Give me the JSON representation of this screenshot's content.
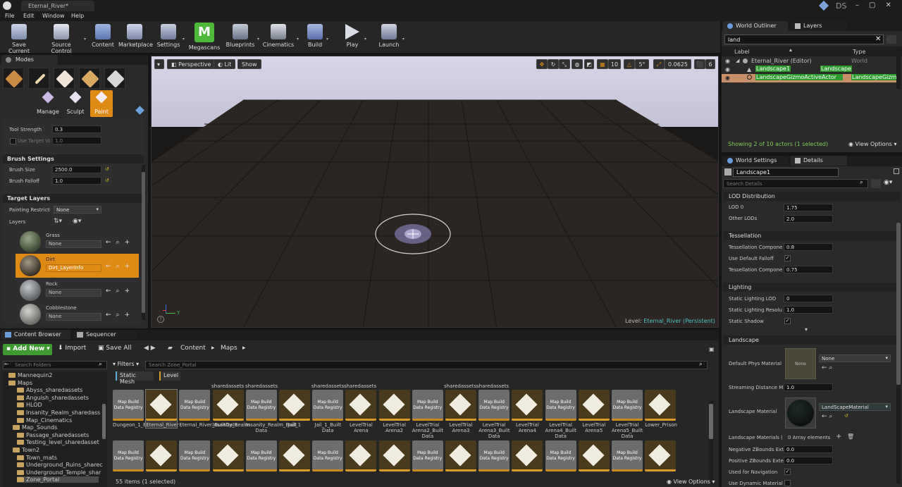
{
  "window": {
    "doc_tab": "Eternal_River*",
    "user": "DS"
  },
  "menu": [
    "File",
    "Edit",
    "Window",
    "Help"
  ],
  "toolbar": [
    "Save Current",
    "Source Control",
    "Content",
    "Marketplace",
    "Settings",
    "Megascans",
    "Blueprints",
    "Cinematics",
    "Build",
    "Play",
    "Launch"
  ],
  "modes": {
    "title": "Modes",
    "tabs": [
      "Manage",
      "Sculpt",
      "Paint"
    ],
    "tool_strength_label": "Tool Strength",
    "tool_strength": "0.3",
    "use_target_label": "Use Target Va",
    "use_target_value": "1.0",
    "brush_settings": "Brush Settings",
    "brush_size_label": "Brush Size",
    "brush_size": "2500.0",
    "brush_falloff_label": "Brush Falloff",
    "brush_falloff": "1.0",
    "target_layers": "Target Layers",
    "painting_restriction_label": "Painting Restricti",
    "painting_restriction": "None",
    "layers_label": "Layers",
    "layers": [
      {
        "name": "Grass",
        "info": "None",
        "color": "#5b6b3f"
      },
      {
        "name": "Dirt",
        "info": "Dirt_LayerInfo",
        "color": "#5c4f3e"
      },
      {
        "name": "Rock",
        "info": "None",
        "color": "#8a8c8e"
      },
      {
        "name": "Cobblestone",
        "info": "None",
        "color": "#9a9c98"
      }
    ]
  },
  "viewport": {
    "perspective": "Perspective",
    "lit": "Lit",
    "show": "Show",
    "grid_snap": "10",
    "rot_snap": "5°",
    "scale_snap": "0.0625",
    "cam_speed": "6",
    "level_label": "Level:",
    "level_name": "Eternal_River (Persistent)"
  },
  "outliner": {
    "tabs": [
      "World Outliner",
      "Layers"
    ],
    "search": "land",
    "col_label": "Label",
    "col_type": "Type",
    "rows": [
      {
        "label": "Eternal_River (Editor)",
        "type": "World"
      },
      {
        "label": "Landscape1",
        "type": "Landscape"
      },
      {
        "label": "LandscapeGizmoActiveActor",
        "type": "LandscapeGizmoA"
      }
    ],
    "status": "Showing 2 of 10 actors (1 selected)",
    "view_options": "View Options"
  },
  "details": {
    "tabs": [
      "World Settings",
      "Details"
    ],
    "object_name": "Landscape1",
    "search_placeholder": "Search Details",
    "lod_section": "LOD Distribution",
    "lod0_label": "LOD 0",
    "lod0": "1.75",
    "other_lods_label": "Other LODs",
    "other_lods": "2.0",
    "tess_section": "Tessellation",
    "tess1_label": "Tessellation Compone",
    "tess1": "0.8",
    "default_falloff_label": "Use Default Falloff",
    "tess2_label": "Tessellation Compone",
    "tess2": "0.75",
    "lighting_section": "Lighting",
    "static_lod_label": "Static Lighting LOD",
    "static_lod": "0",
    "static_res_label": "Static Lighting Resolu",
    "static_res": "1.0",
    "static_shadow_label": "Static Shadow",
    "landscape_section": "Landscape",
    "phys_mat_label": "Default Phys Material",
    "phys_mat": "None",
    "phys_thumb": "None",
    "stream_label": "Streaming Distance M",
    "stream": "1.0",
    "land_mat_label": "Landscape Material",
    "land_mat": "LandScapeMaterial",
    "land_mats_label": "Landscape Materials (",
    "land_mats_value": "0 Array elements",
    "neg_z_label": "Negative ZBounds Ext",
    "neg_z": "0.0",
    "pos_z_label": "Positive ZBounds Exte",
    "pos_z": "0.0",
    "nav_label": "Used for Navigation",
    "dyn_label": "Use Dynamic Material"
  },
  "content_browser": {
    "tabs": [
      "Content Browser",
      "Sequencer"
    ],
    "add_new": "Add New",
    "import": "Import",
    "save_all": "Save All",
    "path": [
      "Content",
      "Maps"
    ],
    "search_folders": "Search Folders",
    "filters": "Filters",
    "search_assets": "Search Zone_Portal",
    "chips": [
      "Static Mesh",
      "Level"
    ],
    "folders": [
      "Mannequin2",
      "Maps",
      "Abyss_sharedassets",
      "Anguish_sharedassets",
      "HLOD",
      "Insanity_Realm_sharedass",
      "Map_Cinematics",
      "Map_Sounds",
      "Passage_sharedassets",
      "Testing_level_sharedasset",
      "Town2",
      "Town_mats",
      "Underground_Ruins_sharec",
      "Underground_Temple_shar",
      "Zone_Portal"
    ],
    "top_overflow": [
      "sharedassets",
      "sharedassets",
      "sharedassets",
      "sharedassets"
    ],
    "row1": [
      {
        "kind": "mbdr",
        "cap": "Dungeon_1_BuiltData"
      },
      {
        "kind": "world",
        "cap": "Eternal_River"
      },
      {
        "kind": "mbdr",
        "cap": "Eternal_River_BuiltData"
      },
      {
        "kind": "world",
        "cap": "Insanity_Realm"
      },
      {
        "kind": "mbdr",
        "cap": "Insanity_Realm_Built Data"
      },
      {
        "kind": "world",
        "cap": "Jail_1"
      },
      {
        "kind": "mbdr",
        "cap": "Jail_1_Built Data"
      },
      {
        "kind": "world",
        "cap": "LevelTrial Arena"
      },
      {
        "kind": "world",
        "cap": "LevelTrial Arena2"
      },
      {
        "kind": "mbdr",
        "cap": "LevelTrial Arena2_Built Data"
      },
      {
        "kind": "world",
        "cap": "LevelTrial Arena3"
      },
      {
        "kind": "mbdr",
        "cap": "LevelTrial Arena3_Built Data"
      },
      {
        "kind": "world",
        "cap": "LevelTrial Arena4"
      },
      {
        "kind": "mbdr",
        "cap": "LevelTrial Arena4_Built Data"
      },
      {
        "kind": "world",
        "cap": "LevelTrial Arena5"
      },
      {
        "kind": "mbdr",
        "cap": "LevelTrial Arena5_Built Data"
      },
      {
        "kind": "world",
        "cap": "Lower_Prison"
      }
    ],
    "row2": [
      "mbdr",
      "world",
      "mbdr",
      "world",
      "mbdr",
      "world",
      "mbdr",
      "world",
      "world",
      "mbdr",
      "world",
      "mbdr",
      "world",
      "mbdr",
      "world",
      "mbdr",
      "world"
    ],
    "mbdr_label": "Map Build Data Registry",
    "status": "55 items (1 selected)",
    "view_options": "View Options"
  }
}
